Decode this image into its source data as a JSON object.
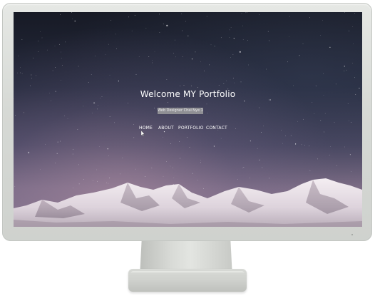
{
  "site": {
    "title": "Welcome MY Portfolio",
    "tagline": "Web Designer Chai Nye 1"
  },
  "nav": {
    "items": [
      {
        "label": "HOME"
      },
      {
        "label": "ABOUT"
      },
      {
        "label": "PORTFOLIO"
      },
      {
        "label": "CONTACT"
      }
    ]
  },
  "icons": {
    "cursor": "mouse-pointer-icon"
  },
  "colors": {
    "sky_top": "#171a25",
    "sky_mid": "#4a4761",
    "sky_bottom": "#8c7a91",
    "bezel": "#d6d9d5",
    "text": "#ffffff",
    "tagline_bg": "#8f8f94"
  }
}
